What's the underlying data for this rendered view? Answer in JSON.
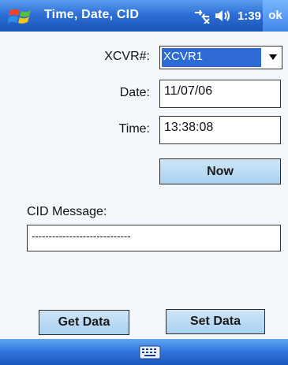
{
  "titlebar": {
    "title": "Time, Date, CID",
    "clock": "1:39",
    "ok_label": "ok",
    "icons": [
      "windows-start-icon",
      "connectivity-icon",
      "speaker-icon"
    ]
  },
  "form": {
    "xcvr_label": "XCVR#:",
    "xcvr_value": "XCVR1",
    "date_label": "Date:",
    "date_value": "11/07/06",
    "time_label": "Time:",
    "time_value": "13:38:08",
    "now_label": "Now",
    "cid_label": "CID Message:",
    "cid_value": "-----------------------------"
  },
  "buttons": {
    "get_data": "Get Data",
    "set_data": "Set Data"
  },
  "menubar": {
    "icons": [
      "keyboard-icon"
    ]
  },
  "colors": {
    "title_bar": "#2d6fd6",
    "button_fill": "#b9dbf3",
    "selection": "#2e6ad3"
  }
}
